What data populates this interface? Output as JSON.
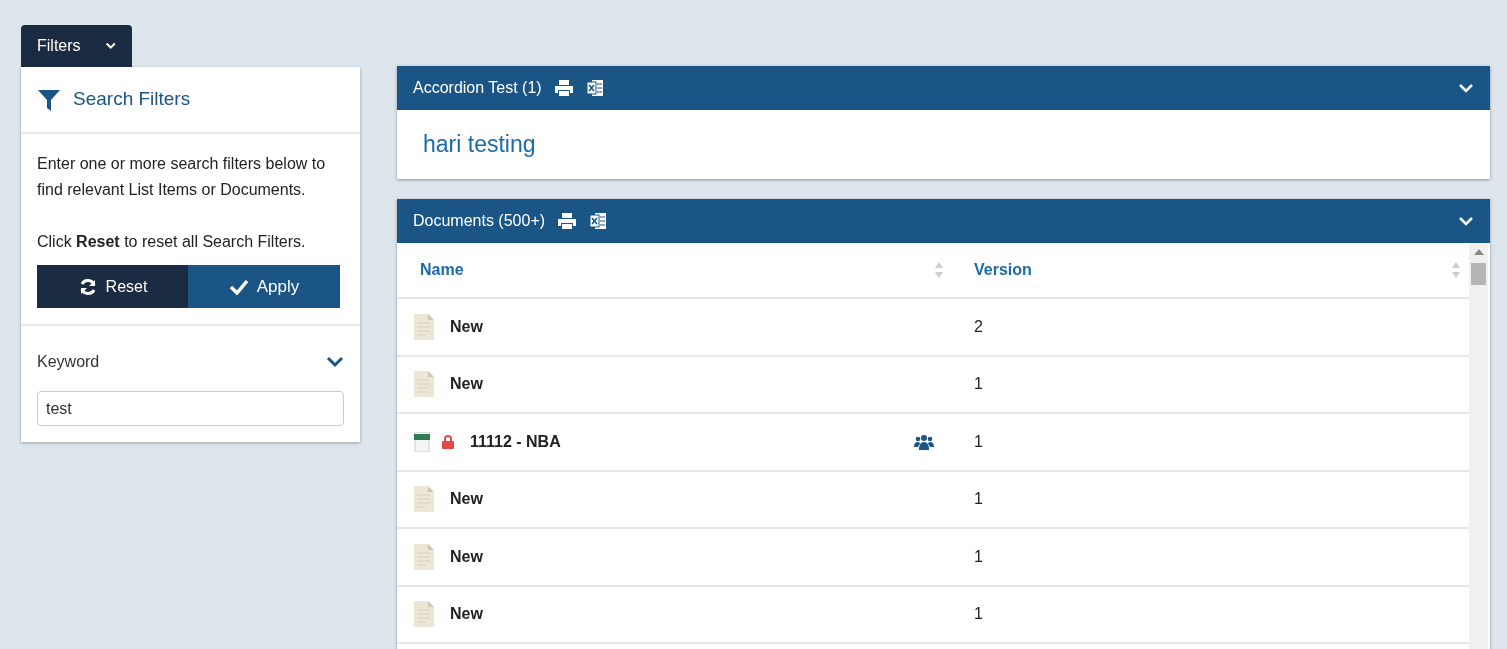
{
  "filters_tab": {
    "label": "Filters"
  },
  "search_filters": {
    "title": "Search Filters",
    "description": "Enter one or more search filters below to find relevant List Items or Documents.",
    "hint": "Click **Reset** to reset all Search Filters.",
    "reset_button": "Reset",
    "apply_button": "Apply"
  },
  "keyword": {
    "label": "Keyword",
    "value": "test"
  },
  "accordion": {
    "title": "Accordion Test (1)",
    "link": "hari testing"
  },
  "documents": {
    "title": "Documents (500+)",
    "columns": [
      "Name",
      "Version"
    ],
    "rows": [
      {
        "kind": "document",
        "name": "New",
        "locked": false,
        "shared": false,
        "version": "2"
      },
      {
        "kind": "document",
        "name": "New",
        "locked": false,
        "shared": false,
        "version": "1"
      },
      {
        "kind": "spreadsheet",
        "name": "11112 - NBA",
        "locked": true,
        "shared": true,
        "version": "1"
      },
      {
        "kind": "document",
        "name": "New",
        "locked": false,
        "shared": false,
        "version": "1"
      },
      {
        "kind": "document",
        "name": "New",
        "locked": false,
        "shared": false,
        "version": "1"
      },
      {
        "kind": "document",
        "name": "New",
        "locked": false,
        "shared": false,
        "version": "1"
      }
    ]
  }
}
